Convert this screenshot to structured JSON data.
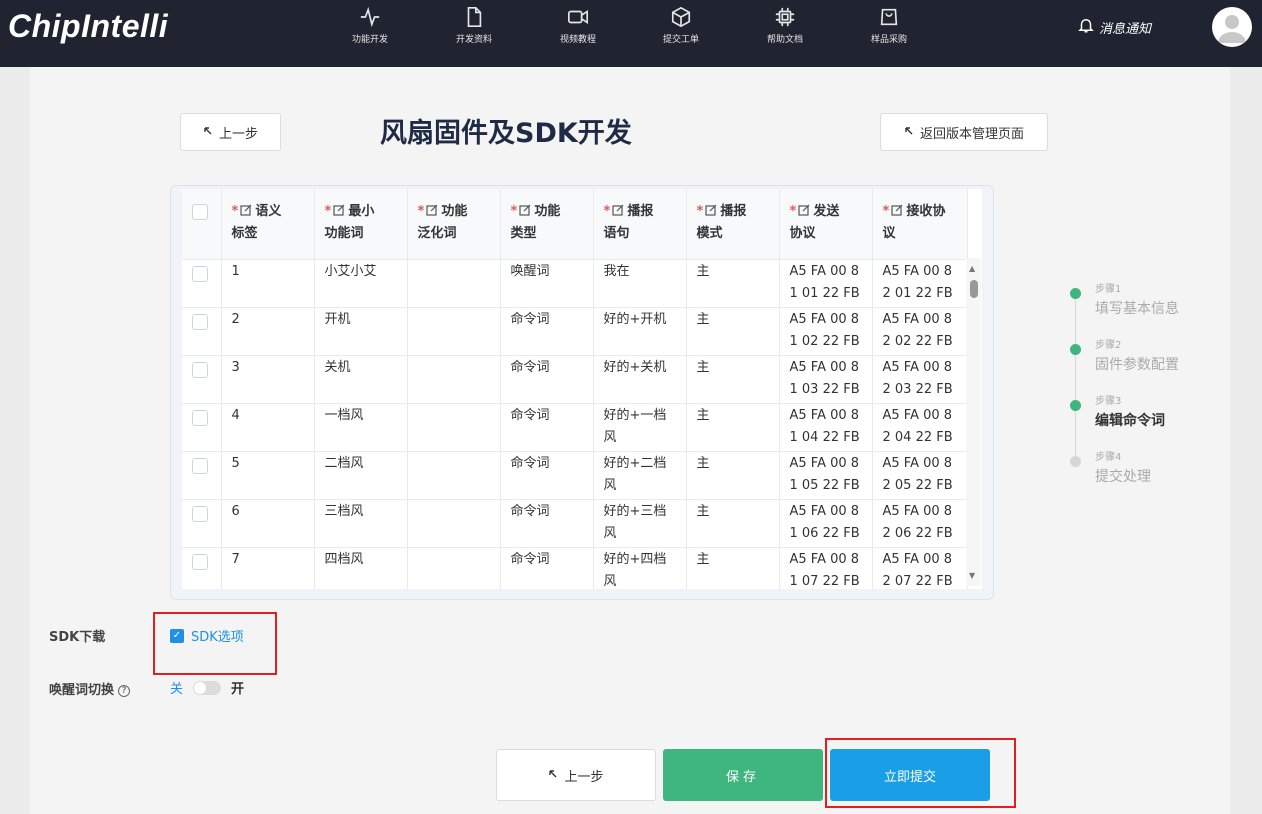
{
  "brand": {
    "logo_text": "ChipIntelli"
  },
  "nav": {
    "items": [
      {
        "label": "功能开发",
        "icon": "activity-icon"
      },
      {
        "label": "开发资料",
        "icon": "document-icon"
      },
      {
        "label": "视频教程",
        "icon": "video-icon"
      },
      {
        "label": "提交工单",
        "icon": "cube-icon"
      },
      {
        "label": "帮助文档",
        "icon": "chip-icon"
      },
      {
        "label": "样品采购",
        "icon": "shopping-bag-icon"
      }
    ],
    "notify_label": "消息通知"
  },
  "header": {
    "prev_label": "上一步",
    "title": "风扇固件及SDK开发",
    "back_label": "返回版本管理页面"
  },
  "table": {
    "columns": [
      {
        "line1": "语义",
        "line2": "标签"
      },
      {
        "line1": "最小",
        "line2": "功能词"
      },
      {
        "line1": "功能",
        "line2": "泛化词"
      },
      {
        "line1": "功能",
        "line2": "类型"
      },
      {
        "line1": "播报",
        "line2": "语句"
      },
      {
        "line1": "播报",
        "line2": "模式"
      },
      {
        "line1": "发送",
        "line2": "协议"
      },
      {
        "line1": "接收协",
        "line2": "议"
      }
    ],
    "required_mark": "*",
    "rows": [
      {
        "id": "1",
        "word": "小艾小艾",
        "gen": "",
        "type": "唤醒词",
        "reply1": "我在",
        "reply2": "",
        "mode": "主",
        "send1": "A5 FA 00 8",
        "send2": "1 01 22 FB",
        "recv1": "A5 FA 00 8",
        "recv2": "2 01 22 FB"
      },
      {
        "id": "2",
        "word": "开机",
        "gen": "",
        "type": "命令词",
        "reply1": "好的+开机",
        "reply2": "",
        "mode": "主",
        "send1": "A5 FA 00 8",
        "send2": "1 02 22 FB",
        "recv1": "A5 FA 00 8",
        "recv2": "2 02 22 FB"
      },
      {
        "id": "3",
        "word": "关机",
        "gen": "",
        "type": "命令词",
        "reply1": "好的+关机",
        "reply2": "",
        "mode": "主",
        "send1": "A5 FA 00 8",
        "send2": "1 03 22 FB",
        "recv1": "A5 FA 00 8",
        "recv2": "2 03 22 FB"
      },
      {
        "id": "4",
        "word": "一档风",
        "gen": "",
        "type": "命令词",
        "reply1": "好的+一档",
        "reply2": "风",
        "mode": "主",
        "send1": "A5 FA 00 8",
        "send2": "1 04 22 FB",
        "recv1": "A5 FA 00 8",
        "recv2": "2 04 22 FB"
      },
      {
        "id": "5",
        "word": "二档风",
        "gen": "",
        "type": "命令词",
        "reply1": "好的+二档",
        "reply2": "风",
        "mode": "主",
        "send1": "A5 FA 00 8",
        "send2": "1 05 22 FB",
        "recv1": "A5 FA 00 8",
        "recv2": "2 05 22 FB"
      },
      {
        "id": "6",
        "word": "三档风",
        "gen": "",
        "type": "命令词",
        "reply1": "好的+三档",
        "reply2": "风",
        "mode": "主",
        "send1": "A5 FA 00 8",
        "send2": "1 06 22 FB",
        "recv1": "A5 FA 00 8",
        "recv2": "2 06 22 FB"
      },
      {
        "id": "7",
        "word": "四档风",
        "gen": "",
        "type": "命令词",
        "reply1": "好的+四档",
        "reply2": "风",
        "mode": "主",
        "send1": "A5 FA 00 8",
        "send2": "1 07 22 FB",
        "recv1": "A5 FA 00 8",
        "recv2": "2 07 22 FB"
      }
    ]
  },
  "steps": [
    {
      "label": "步骤1",
      "name": "填写基本信息",
      "state": "done",
      "color": "#3fb57f"
    },
    {
      "label": "步骤2",
      "name": "固件参数配置",
      "state": "done",
      "color": "#3fb57f"
    },
    {
      "label": "步骤3",
      "name": "编辑命令词",
      "state": "active",
      "color": "#3fb57f"
    },
    {
      "label": "步骤4",
      "name": "提交处理",
      "state": "pending",
      "color": "#d6d6d6"
    }
  ],
  "sdk": {
    "label": "SDK下载",
    "option_label": "SDK选项",
    "checked": true,
    "checkmark": "✓"
  },
  "wake_switch": {
    "label": "唤醒词切换",
    "help": "?",
    "off_label": "关",
    "on_label": "开",
    "state": "off"
  },
  "footer": {
    "prev_label": "上一步",
    "save_label": "保存",
    "submit_label": "立即提交"
  },
  "colors": {
    "nav_bg": "#1f2430",
    "save_green": "#3fb57f",
    "submit_blue": "#1a9ee6",
    "highlight_red": "#e02020"
  }
}
